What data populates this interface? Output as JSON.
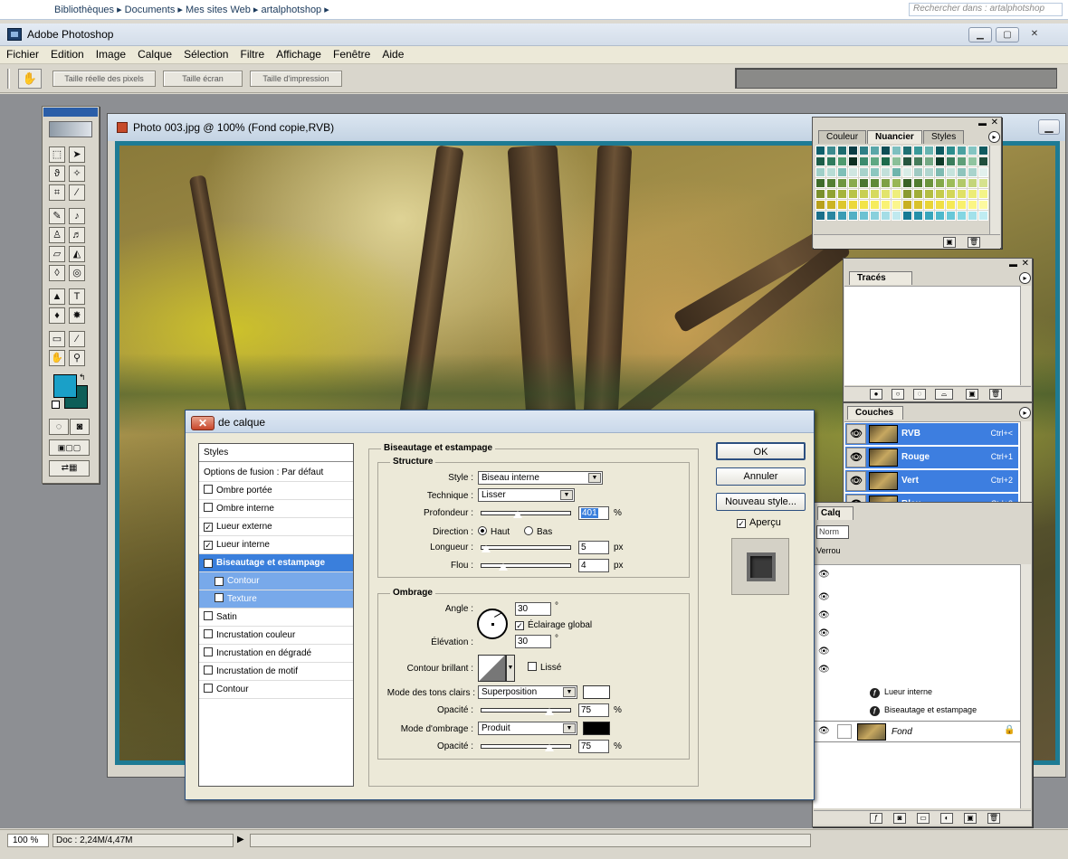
{
  "explorer": {
    "breadcrumb": "Bibliothèques ▸ Documents ▸ Mes sites Web ▸ artalphotshop ▸",
    "search_placeholder": "Rechercher dans : artalphotshop"
  },
  "app": {
    "title": "Adobe Photoshop"
  },
  "menu": [
    "Fichier",
    "Edition",
    "Image",
    "Calque",
    "Sélection",
    "Filtre",
    "Affichage",
    "Fenêtre",
    "Aide"
  ],
  "options": {
    "actual_pixels": "Taille réelle des pixels",
    "fit_screen": "Taille écran",
    "print_size": "Taille d'impression"
  },
  "document": {
    "title": "Photo 003.jpg @ 100% (Fond copie,RVB)"
  },
  "status": {
    "zoom": "100 %",
    "doc": "Doc : 2,24M/4,47M"
  },
  "swatches_panel": {
    "tabs": [
      "Couleur",
      "Nuancier",
      "Styles"
    ],
    "active_tab": "Nuancier",
    "colors": [
      [
        "#0f5f6b",
        "#3c8a8e",
        "#1d6b6e",
        "#0a3c44",
        "#2e7f86",
        "#5aa6a8",
        "#0e4d55",
        "#7dbfbf",
        "#1f6f72",
        "#3a9999",
        "#66b3b0",
        "#0c5a60",
        "#2b8c8c",
        "#4aa0a0",
        "#84c5c2",
        "#105a5f"
      ],
      [
        "#1c5c48",
        "#2f7a5d",
        "#4f9a6e",
        "#0d2e20",
        "#3c8b6e",
        "#5fa883",
        "#1e6a4c",
        "#8bbf98",
        "#26543e",
        "#467c5b",
        "#73a884",
        "#0d3a28",
        "#3a7c5c",
        "#5e9e78",
        "#90c4a0",
        "#204e3c"
      ],
      [
        "#9fcfc8",
        "#b8dcd5",
        "#7fbfb7",
        "#cfe6e0",
        "#a7d2cb",
        "#8cc7bf",
        "#c2e0da",
        "#6fb4ab",
        "#d8ece6",
        "#9fcac2",
        "#b0d6cf",
        "#7dbab1",
        "#c6e3dc",
        "#8fc4bc",
        "#a9d3cc",
        "#e2f0ec"
      ],
      [
        "#3f6b2a",
        "#557f33",
        "#6f9640",
        "#8aab4e",
        "#4a7630",
        "#608a38",
        "#7ea046",
        "#98b656",
        "#3a6226",
        "#527c30",
        "#6a933c",
        "#84a84a",
        "#9dbc58",
        "#b2c968",
        "#c4d57a",
        "#d6e28e"
      ],
      [
        "#7a8f2c",
        "#90a233",
        "#a5b43c",
        "#b9c446",
        "#c8cf52",
        "#d6da5e",
        "#e2e46c",
        "#eeee7c",
        "#8a9a30",
        "#a0ad38",
        "#b3bd42",
        "#c5cb4c",
        "#d3d658",
        "#e0e166",
        "#ecec76",
        "#f4f488"
      ],
      [
        "#b8a01c",
        "#cbb424",
        "#dcc72e",
        "#ebd83a",
        "#f2e448",
        "#f6ec5c",
        "#f9f274",
        "#fbf68e",
        "#c8b022",
        "#d9c32c",
        "#e8d436",
        "#f0df44",
        "#f5e956",
        "#f8f06c",
        "#fbf584",
        "#fdf9a0"
      ],
      [
        "#1b6f8a",
        "#2a86a0",
        "#3b9cb4",
        "#52b0c4",
        "#6cc2d2",
        "#88d0dc",
        "#a4dde6",
        "#c0e9ef",
        "#167a94",
        "#2690a8",
        "#38a5bb",
        "#4eb8cb",
        "#68c8d8",
        "#84d6e2",
        "#a2e1ea",
        "#bfecf2"
      ]
    ]
  },
  "paths_panel": {
    "tab": "Tracés"
  },
  "channels_panel": {
    "tab": "Couches",
    "rows": [
      {
        "name": "RVB",
        "shortcut": "Ctrl+<"
      },
      {
        "name": "Rouge",
        "shortcut": "Ctrl+1"
      },
      {
        "name": "Vert",
        "shortcut": "Ctrl+2"
      },
      {
        "name": "Bleu",
        "shortcut": "Ctrl+3"
      }
    ]
  },
  "layers_panel": {
    "tab": "Calq",
    "blend_mode": "Norm",
    "lock_label": "Verrou",
    "effects": [
      "Lueur interne",
      "Biseautage et estampage"
    ],
    "background_layer": "Fond"
  },
  "dialog": {
    "title": "Style de calque",
    "list_header": "Styles",
    "blend_options": "Options de fusion : Par défaut",
    "effects": [
      {
        "label": "Ombre portée",
        "checked": false
      },
      {
        "label": "Ombre interne",
        "checked": false
      },
      {
        "label": "Lueur externe",
        "checked": true
      },
      {
        "label": "Lueur interne",
        "checked": true
      },
      {
        "label": "Biseautage et estampage",
        "checked": true,
        "selected": true
      },
      {
        "label": "Contour",
        "checked": true,
        "sub": true
      },
      {
        "label": "Texture",
        "checked": false,
        "sub": true
      },
      {
        "label": "Satin",
        "checked": false
      },
      {
        "label": "Incrustation couleur",
        "checked": false
      },
      {
        "label": "Incrustation en dégradé",
        "checked": false
      },
      {
        "label": "Incrustation de motif",
        "checked": false
      },
      {
        "label": "Contour",
        "checked": false
      }
    ],
    "section_title": "Biseautage et estampage",
    "structure": {
      "title": "Structure",
      "style_label": "Style :",
      "style_value": "Biseau interne",
      "technique_label": "Technique :",
      "technique_value": "Lisser",
      "depth_label": "Profondeur :",
      "depth_value": "401",
      "depth_unit": "%",
      "direction_label": "Direction :",
      "direction_up": "Haut",
      "direction_down": "Bas",
      "size_label": "Longueur :",
      "size_value": "5",
      "size_unit": "px",
      "soften_label": "Flou :",
      "soften_value": "4",
      "soften_unit": "px"
    },
    "shading": {
      "title": "Ombrage",
      "angle_label": "Angle :",
      "angle_value": "30",
      "angle_unit": "°",
      "global_light": "Éclairage global",
      "altitude_label": "Élévation :",
      "altitude_value": "30",
      "altitude_unit": "°",
      "gloss_label": "Contour brillant :",
      "antialias": "Lissé",
      "highlight_label": "Mode des tons clairs :",
      "highlight_value": "Superposition",
      "highlight_opacity_label": "Opacité :",
      "highlight_opacity": "75",
      "pct": "%",
      "shadow_label": "Mode d'ombrage :",
      "shadow_value": "Produit",
      "shadow_opacity_label": "Opacité :",
      "shadow_opacity": "75",
      "highlight_color": "#ffffff",
      "shadow_color": "#000000"
    },
    "buttons": {
      "ok": "OK",
      "cancel": "Annuler",
      "new_style": "Nouveau style...",
      "preview": "Aperçu"
    }
  },
  "colors": {
    "foreground": "#1aa0c8",
    "background": "#0e5e58",
    "selection": "#3a7fdc"
  }
}
